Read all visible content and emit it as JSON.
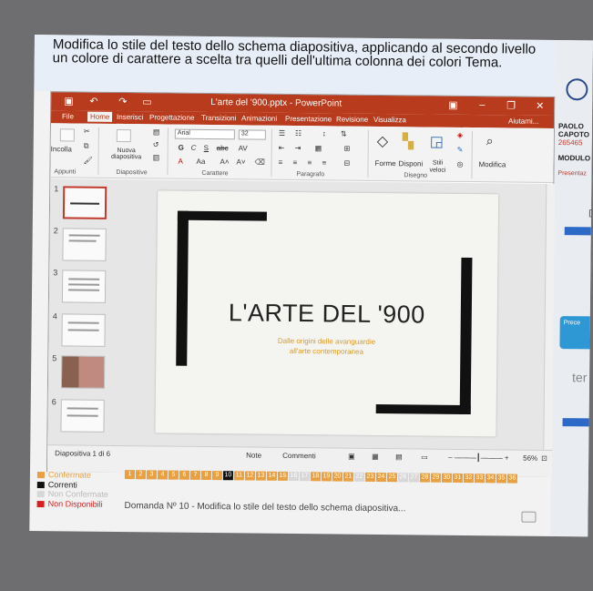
{
  "question": {
    "text": "Modifica lo stile del testo dello schema diapositiva, applicando al secondo livello un colore di carattere a scelta tra quelli dell'ultima colonna dei colori Tema."
  },
  "ppt": {
    "title": "L'arte del '900.pptx - PowerPoint",
    "tabs": [
      "File",
      "Home",
      "Inserisci",
      "Progettazione",
      "Transizioni",
      "Animazioni",
      "Presentazione",
      "Revisione",
      "Visualizza"
    ],
    "help": "Aiutami...",
    "ribbon": {
      "paste": "Incolla",
      "new_slide": "Nuova diapositiva",
      "font_name": "Arial",
      "font_size": "32",
      "shapes": "Forme",
      "arrange": "Disponi",
      "styles": "Stili veloci",
      "edit": "Modifica",
      "groups": [
        "Appunti",
        "Diapositive",
        "Carattere",
        "Paragrafo",
        "Disegno"
      ]
    },
    "thumb_numbers": [
      "1",
      "2",
      "3",
      "4",
      "5",
      "6"
    ],
    "slide": {
      "title": "L'ARTE DEL '900",
      "subtitle": "Dalle origini delle avanguardie all'arte contemporanea"
    },
    "status": {
      "slide_info": "Diapositiva 1 di 6",
      "notes": "Note",
      "comments": "Commenti",
      "zoom": "56%"
    }
  },
  "right_panel": {
    "name1": "PAOLO",
    "name2": "CAPOTO",
    "code": "265465",
    "module": "MODULO",
    "presentation": "Presentaz",
    "prev": "Prece",
    "ter": "ter",
    "d": "D"
  },
  "legend": {
    "confirmed": "Confermate",
    "current": "Correnti",
    "not_confirmed": "Non Confermate",
    "not_available": "Non Disponibili",
    "colors": {
      "confirmed": "#e8a040",
      "current": "#111111",
      "not_confirmed": "#d7d7d7",
      "not_available": "#d62020"
    }
  },
  "question_numbers": [
    "1",
    "2",
    "3",
    "4",
    "5",
    "6",
    "7",
    "8",
    "9",
    "10",
    "11",
    "12",
    "13",
    "14",
    "15",
    "16",
    "17",
    "18",
    "19",
    "20",
    "21",
    "22",
    "23",
    "24",
    "25",
    "26",
    "27",
    "28",
    "29",
    "30",
    "31",
    "32",
    "33",
    "34",
    "35",
    "36"
  ],
  "current_question": "10",
  "domanda": "Domanda Nº 10 - Modifica lo stile del testo dello schema diapositiva..."
}
